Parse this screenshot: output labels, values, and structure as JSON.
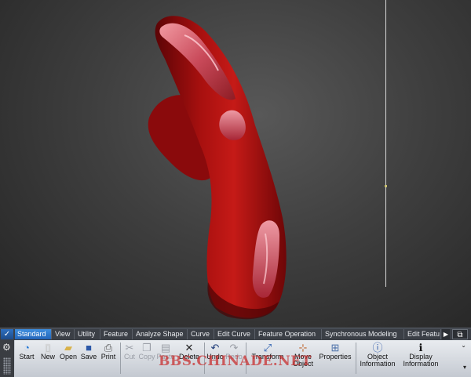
{
  "ribbon": {
    "tabs": [
      {
        "label": "Standard"
      },
      {
        "label": "View"
      },
      {
        "label": "Utility"
      },
      {
        "label": "Feature"
      },
      {
        "label": "Analyze Shape"
      },
      {
        "label": "Curve"
      },
      {
        "label": "Edit Curve"
      },
      {
        "label": "Feature Operation"
      },
      {
        "label": "Synchronous Modeling"
      },
      {
        "label": "Edit Featu"
      }
    ],
    "active_tab": "Standard",
    "tools": [
      {
        "label": "Start",
        "icon": "start-icon"
      },
      {
        "label": "New",
        "icon": "new-file-icon"
      },
      {
        "label": "Open",
        "icon": "open-folder-icon"
      },
      {
        "label": "Save",
        "icon": "save-icon"
      },
      {
        "label": "Print",
        "icon": "print-icon"
      },
      {
        "label": "Cut",
        "icon": "cut-icon"
      },
      {
        "label": "Copy",
        "icon": "copy-icon"
      },
      {
        "label": "Paste",
        "icon": "paste-icon"
      },
      {
        "label": "Delete",
        "icon": "delete-icon"
      },
      {
        "label": "Undo",
        "icon": "undo-icon"
      },
      {
        "label": "Redo",
        "icon": "redo-icon"
      },
      {
        "label": "Transform",
        "icon": "transform-icon"
      },
      {
        "label": "Move Object",
        "icon": "move-object-icon"
      },
      {
        "label": "Properties",
        "icon": "properties-icon"
      },
      {
        "label": "Object Information",
        "icon": "object-information-icon"
      },
      {
        "label": "Display Information",
        "icon": "display-information-icon"
      }
    ]
  },
  "watermark": "BBS.CHINADE.NET",
  "colors": {
    "model": "#a50f10",
    "active_tab": "#2f7dd1",
    "ribbon_bg": "#c9ced6"
  }
}
